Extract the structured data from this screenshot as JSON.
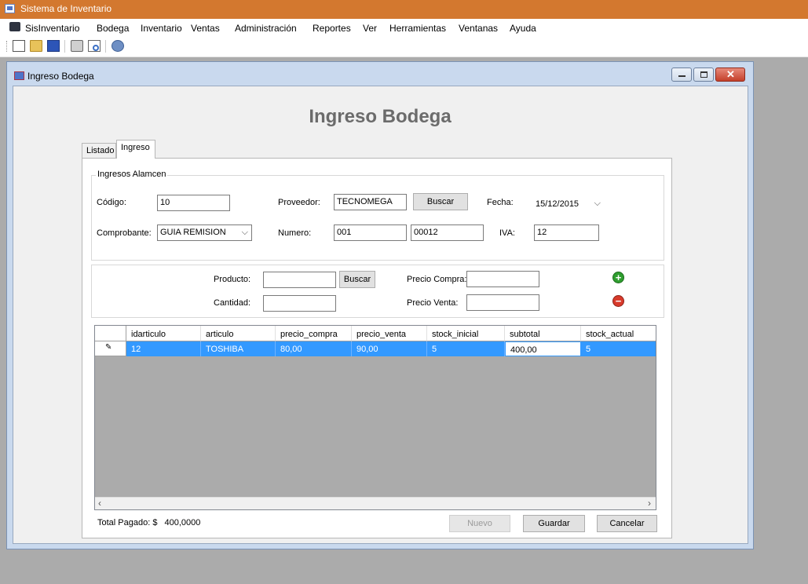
{
  "app": {
    "title": "Sistema de Inventario"
  },
  "menu": [
    "SisInventario",
    "Bodega",
    "Inventario",
    "Ventas",
    "Administración",
    "Reportes",
    "Ver",
    "Herramientas",
    "Ventanas",
    "Ayuda"
  ],
  "toolbar": {
    "icons": [
      "new-icon",
      "open-icon",
      "save-icon",
      "print-icon",
      "print-preview-icon",
      "help-icon"
    ]
  },
  "window": {
    "title": "Ingreso Bodega"
  },
  "heading": "Ingreso Bodega",
  "tabs": [
    {
      "label": "Listado",
      "active": false
    },
    {
      "label": "Ingreso",
      "active": true
    }
  ],
  "group": {
    "legend": "Ingresos Alamcen",
    "codigo_label": "Código:",
    "codigo_value": "10",
    "proveedor_label": "Proveedor:",
    "proveedor_value": "TECNOMEGA",
    "buscar_label": "Buscar",
    "fecha_label": "Fecha:",
    "fecha_value": "15/12/2015",
    "comprobante_label": "Comprobante:",
    "comprobante_value": "GUIA REMISION",
    "numero_label": "Numero:",
    "numero_value1": "001",
    "numero_value2": "00012",
    "iva_label": "IVA:",
    "iva_value": "12"
  },
  "product": {
    "producto_label": "Producto:",
    "producto_value": "",
    "buscar_label": "Buscar",
    "precio_compra_label": "Precio Compra:",
    "precio_compra_value": "",
    "cantidad_label": "Cantidad:",
    "cantidad_value": "",
    "precio_venta_label": "Precio Venta:",
    "precio_venta_value": ""
  },
  "grid": {
    "columns": [
      "idarticulo",
      "articulo",
      "precio_compra",
      "precio_venta",
      "stock_inicial",
      "subtotal",
      "stock_actual"
    ],
    "rows": [
      [
        "12",
        "TOSHIBA",
        "80,00",
        "90,00",
        "5",
        "400,00",
        "5"
      ]
    ]
  },
  "footer": {
    "total_label": "Total Pagado: $",
    "total_value": "400,0000",
    "nuevo_label": "Nuevo",
    "guardar_label": "Guardar",
    "cancelar_label": "Cancelar"
  },
  "colors": {
    "titlebar": "#d3782f",
    "selection": "#3399ff",
    "add": "#2f9e2f",
    "remove": "#d83a2b"
  }
}
